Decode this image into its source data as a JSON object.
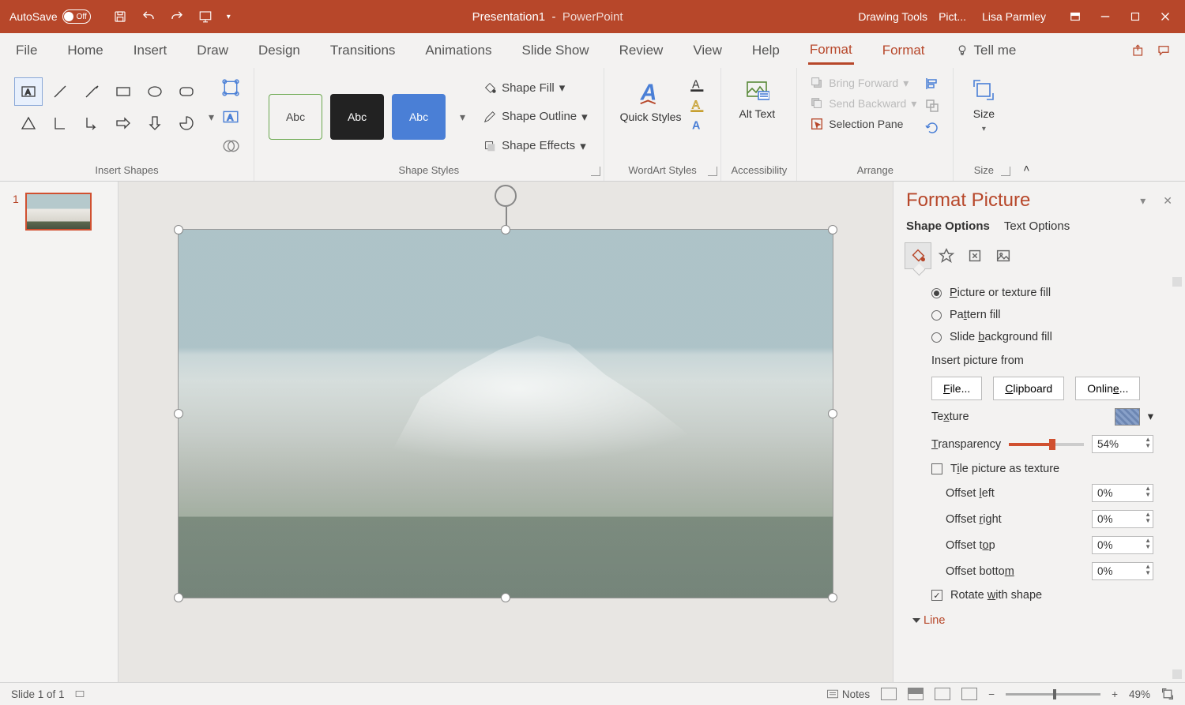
{
  "titlebar": {
    "autosave": "AutoSave",
    "autosave_state": "Off",
    "doc": "Presentation1",
    "app": "PowerPoint",
    "context1": "Drawing Tools",
    "context2": "Pict...",
    "user": "Lisa Parmley"
  },
  "tabs": {
    "file": "File",
    "home": "Home",
    "insert": "Insert",
    "draw": "Draw",
    "design": "Design",
    "transitions": "Transitions",
    "animations": "Animations",
    "slideshow": "Slide Show",
    "review": "Review",
    "view": "View",
    "help": "Help",
    "format1": "Format",
    "format2": "Format",
    "tellme": "Tell me"
  },
  "ribbon": {
    "insert_shapes": "Insert Shapes",
    "shape_styles": "Shape Styles",
    "wordart": "WordArt Styles",
    "accessibility": "Accessibility",
    "arrange": "Arrange",
    "size": "Size",
    "abc": "Abc",
    "shape_fill": "Shape Fill",
    "shape_outline": "Shape Outline",
    "shape_effects": "Shape Effects",
    "quick_styles": "Quick Styles",
    "alt_text": "Alt Text",
    "bring_forward": "Bring Forward",
    "send_backward": "Send Backward",
    "selection_pane": "Selection Pane",
    "size_btn": "Size"
  },
  "pane": {
    "title": "Format Picture",
    "shape_options": "Shape Options",
    "text_options": "Text Options",
    "fill_picture": "Picture or texture fill",
    "fill_pattern": "Pattern fill",
    "fill_slidebg": "Slide background fill",
    "insert_from": "Insert picture from",
    "btn_file": "File...",
    "btn_clipboard": "Clipboard",
    "btn_online": "Online...",
    "texture": "Texture",
    "transparency": "Transparency",
    "transparency_val": "54%",
    "tile": "Tile picture as texture",
    "off_l": "Offset left",
    "off_r": "Offset right",
    "off_t": "Offset top",
    "off_b": "Offset bottom",
    "off_val": "0%",
    "rotate": "Rotate with shape",
    "line": "Line"
  },
  "status": {
    "slide": "Slide 1 of 1",
    "notes": "Notes",
    "zoom": "49%"
  },
  "thumb": {
    "num": "1"
  }
}
